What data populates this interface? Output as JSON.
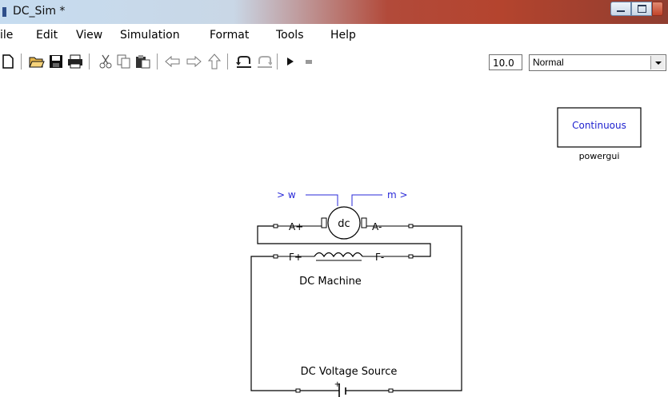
{
  "window": {
    "title": "DC_Sim *"
  },
  "menu": {
    "items": [
      "ile",
      "Edit",
      "View",
      "Simulation",
      "Format",
      "Tools",
      "Help"
    ]
  },
  "toolbar": {
    "stop_time": "10.0",
    "sim_mode": "Normal"
  },
  "powergui": {
    "block_text": "Continuous",
    "label": "powergui"
  },
  "dc_machine": {
    "label": "DC Machine",
    "center_text": "dc",
    "port_a_plus": "A+",
    "port_a_minus": "A-",
    "port_f_plus": "F+",
    "port_f_minus": "F-",
    "out_w": "> w",
    "out_m": "m >"
  },
  "dc_source": {
    "label": "DC Voltage Source",
    "plus": "+"
  },
  "colors": {
    "signal_blue": "#2828d8",
    "wire_black": "#000000",
    "powergui_text": "#1f22cf"
  }
}
